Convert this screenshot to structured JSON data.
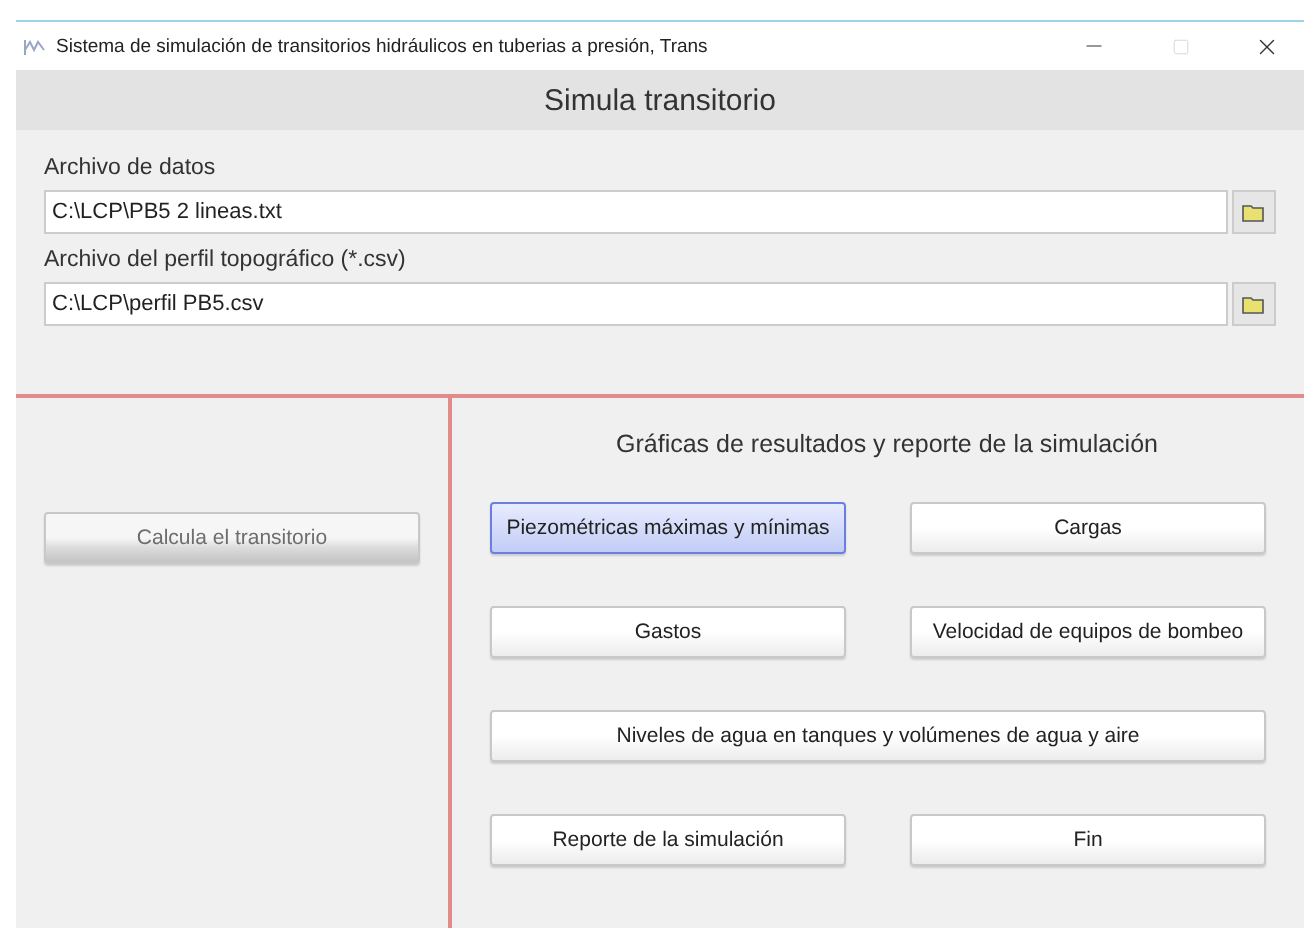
{
  "window": {
    "title": "Sistema de simulación de transitorios hidráulicos en tuberias a presión, Trans"
  },
  "header": {
    "title": "Simula transitorio"
  },
  "files": [
    {
      "label": "Archivo de datos",
      "value": "C:\\LCP\\PB5 2 lineas.txt"
    },
    {
      "label": "Archivo del perfil topográfico (*.csv)",
      "value": "C:\\LCP\\perfil PB5.csv"
    }
  ],
  "left_panel": {
    "button": {
      "label": "Calcula el transitorio",
      "disabled": true
    }
  },
  "right_panel": {
    "title": "Gráficas de resultados y reporte de la simulación",
    "buttons": [
      {
        "label": "Piezométricas máximas y mínimas",
        "focused": true,
        "wide": false
      },
      {
        "label": "Cargas",
        "focused": false,
        "wide": false
      },
      {
        "label": "Gastos",
        "focused": false,
        "wide": false
      },
      {
        "label": "Velocidad de equipos de bombeo",
        "focused": false,
        "wide": false
      },
      {
        "label": "Niveles de agua en tanques y volúmenes de agua y aire",
        "focused": false,
        "wide": true
      },
      {
        "label": "Reporte de la simulación",
        "focused": false,
        "wide": false
      },
      {
        "label": "Fin",
        "focused": false,
        "wide": false
      }
    ]
  }
}
